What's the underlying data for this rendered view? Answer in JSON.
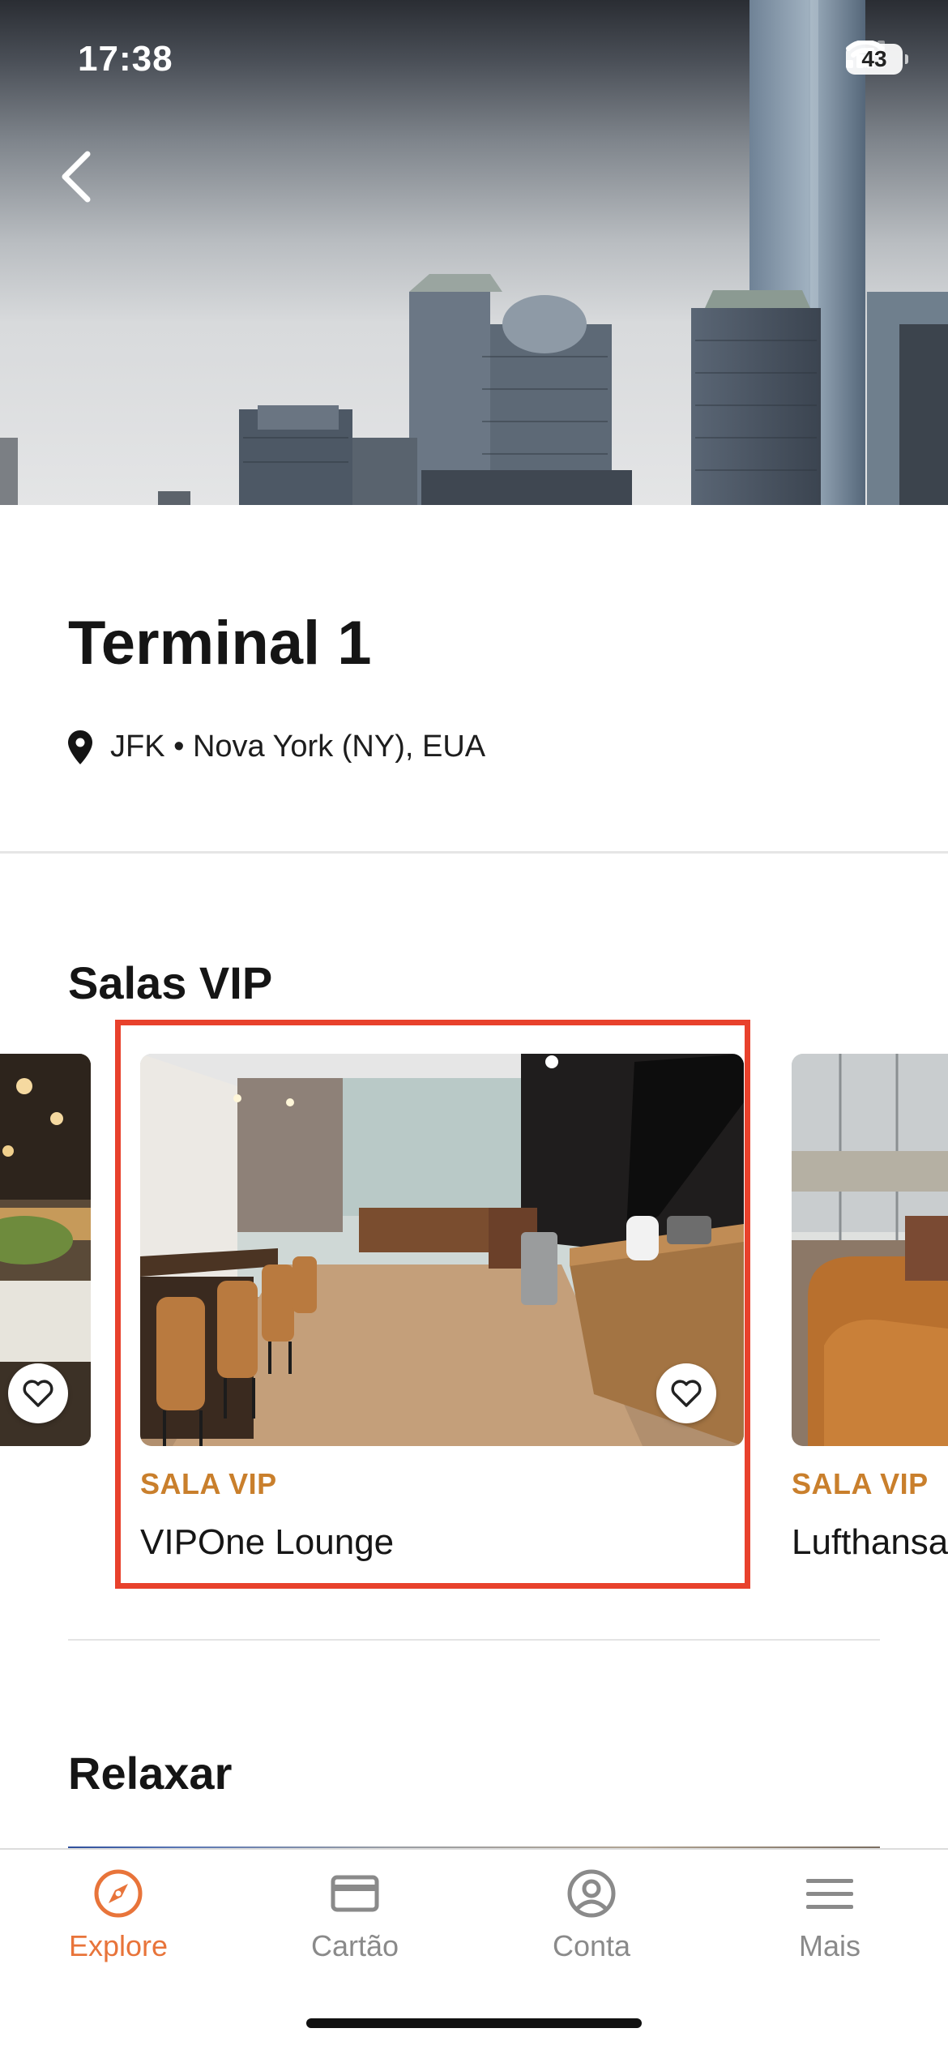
{
  "status_bar": {
    "time": "17:38",
    "battery": "43"
  },
  "header": {
    "title": "Terminal 1",
    "location": "JFK • Nova York (NY), EUA"
  },
  "sections": {
    "lounges_title": "Salas VIP",
    "relax_title": "Relaxar"
  },
  "lounges": [
    {
      "category": "",
      "name": ""
    },
    {
      "category": "SALA VIP",
      "name": "VIPOne Lounge"
    },
    {
      "category": "SALA VIP",
      "name": "Lufthansa"
    }
  ],
  "tabbar": {
    "items": [
      {
        "label": "Explore",
        "icon": "compass-icon",
        "active": true
      },
      {
        "label": "Cartão",
        "icon": "card-icon",
        "active": false
      },
      {
        "label": "Conta",
        "icon": "account-icon",
        "active": false
      },
      {
        "label": "Mais",
        "icon": "menu-icon",
        "active": false
      }
    ]
  },
  "colors": {
    "accent": "#e8743a",
    "category": "#c97f2c",
    "highlight": "#e8412c"
  }
}
